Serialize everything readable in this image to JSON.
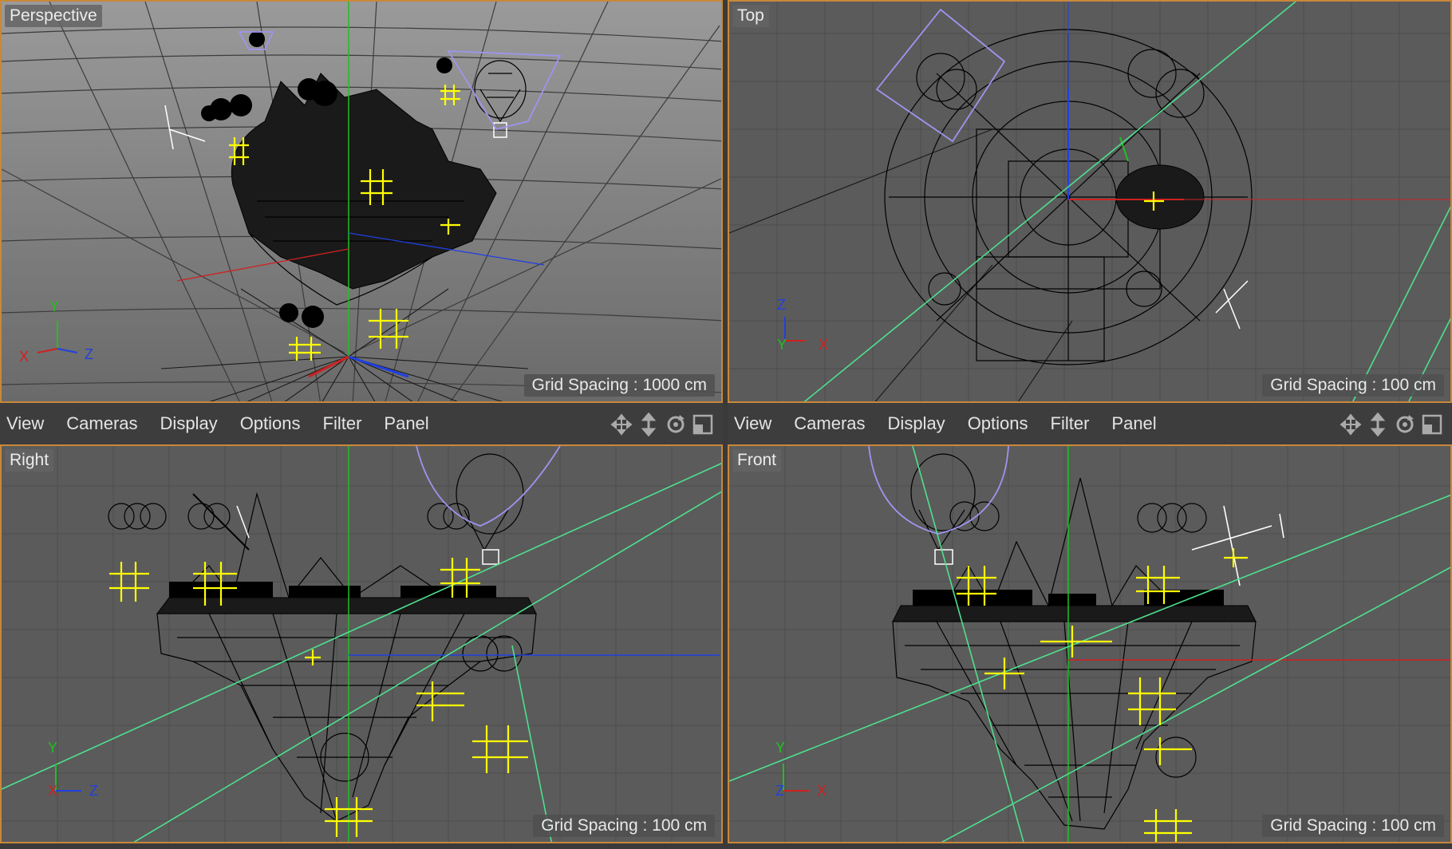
{
  "viewports": {
    "perspective": {
      "title": "Perspective",
      "grid_spacing": "Grid Spacing : 1000 cm",
      "axes": [
        "Y",
        "X",
        "Z"
      ]
    },
    "top": {
      "title": "Top",
      "grid_spacing": "Grid Spacing : 100 cm",
      "axes": [
        "Z",
        "Y",
        "X"
      ]
    },
    "right": {
      "title": "Right",
      "grid_spacing": "Grid Spacing : 100 cm",
      "axes": [
        "Y",
        "X",
        "Z"
      ]
    },
    "front": {
      "title": "Front",
      "grid_spacing": "Grid Spacing : 100 cm",
      "axes": [
        "Y",
        "Z",
        "X"
      ]
    }
  },
  "menubar_left": {
    "items": [
      "View",
      "Cameras",
      "Display",
      "Options",
      "Filter",
      "Panel"
    ]
  },
  "menubar_right": {
    "items": [
      "View",
      "Cameras",
      "Display",
      "Options",
      "Filter",
      "Panel"
    ]
  },
  "nav_icons": [
    "move-view-icon",
    "dolly-view-icon",
    "rotate-view-icon",
    "toggle-layout-icon"
  ],
  "colors": {
    "viewport_bg": "#5b5b5b",
    "border_active": "#c8883a",
    "axis_x": "#d02020",
    "axis_y": "#20c020",
    "axis_z": "#2040e0",
    "light": "#ffff00",
    "camera": "#9d95ee",
    "guide": "#4ee08e"
  }
}
